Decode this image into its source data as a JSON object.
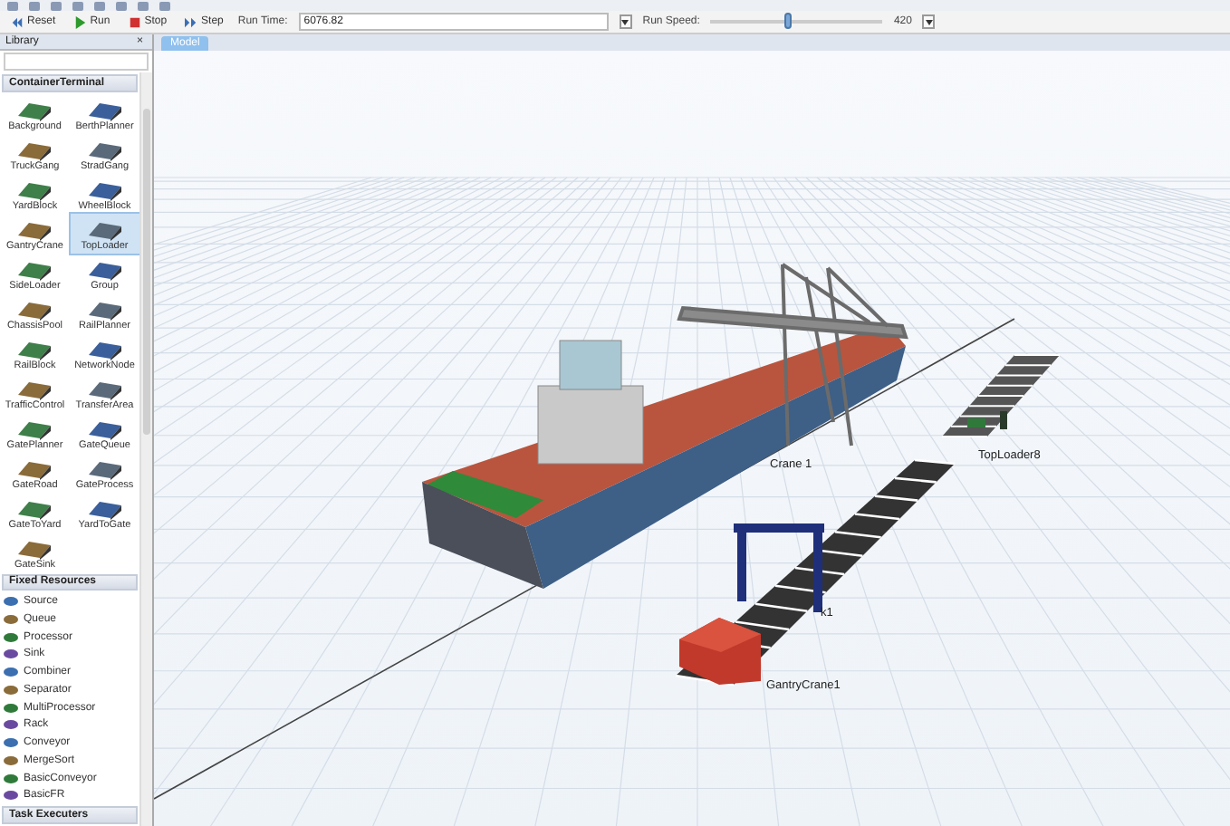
{
  "toolbar": {
    "buttons": [
      {
        "label": "Reset",
        "kind": "reset"
      },
      {
        "label": "Run",
        "kind": "run"
      },
      {
        "label": "Stop",
        "kind": "stop"
      },
      {
        "label": "Step",
        "kind": "step"
      }
    ],
    "run_time_label": "Run Time:",
    "run_time": "6076.82",
    "run_speed_label": "Run Speed:",
    "run_speed": {
      "level": 0.45
    },
    "run_speed_value": "420"
  },
  "library": {
    "title": "Library",
    "close": "×",
    "group_title": "ContainerTerminal",
    "items": [
      {
        "label": "Background",
        "selected": false
      },
      {
        "label": "BerthPlanner",
        "selected": false
      },
      {
        "label": "TruckGang",
        "selected": false
      },
      {
        "label": "StradGang",
        "selected": false
      },
      {
        "label": "YardBlock",
        "selected": false
      },
      {
        "label": "WheelBlock",
        "selected": false
      },
      {
        "label": "GantryCrane",
        "selected": false
      },
      {
        "label": "TopLoader",
        "selected": true
      },
      {
        "label": "SideLoader",
        "selected": false
      },
      {
        "label": "Group",
        "selected": false
      },
      {
        "label": "ChassisPool",
        "selected": false
      },
      {
        "label": "RailPlanner",
        "selected": false
      },
      {
        "label": "RailBlock",
        "selected": false
      },
      {
        "label": "NetworkNode",
        "selected": false
      },
      {
        "label": "TrafficControl",
        "selected": false
      },
      {
        "label": "TransferArea",
        "selected": false
      },
      {
        "label": "GatePlanner",
        "selected": false
      },
      {
        "label": "GateQueue",
        "selected": false
      },
      {
        "label": "GateRoad",
        "selected": false
      },
      {
        "label": "GateProcess",
        "selected": false
      },
      {
        "label": "GateToYard",
        "selected": false
      },
      {
        "label": "YardToGate",
        "selected": false
      },
      {
        "label": "GateSink",
        "selected": false
      }
    ],
    "fixed_title": "Fixed Resources",
    "fixed_items": [
      "Source",
      "Queue",
      "Processor",
      "Sink",
      "Combiner",
      "Separator",
      "MultiProcessor",
      "Rack",
      "Conveyor",
      "MergeSort",
      "BasicConveyor",
      "BasicFR"
    ],
    "task_title": "Task Executers"
  },
  "model": {
    "tab": "Model",
    "labels": [
      {
        "text": "Crane 1",
        "kind": "crane"
      },
      {
        "text": "TopLoader8",
        "kind": "toploader"
      },
      {
        "text": "k1",
        "kind": "block"
      },
      {
        "text": "GantryCrane1",
        "kind": "gantry"
      }
    ]
  }
}
